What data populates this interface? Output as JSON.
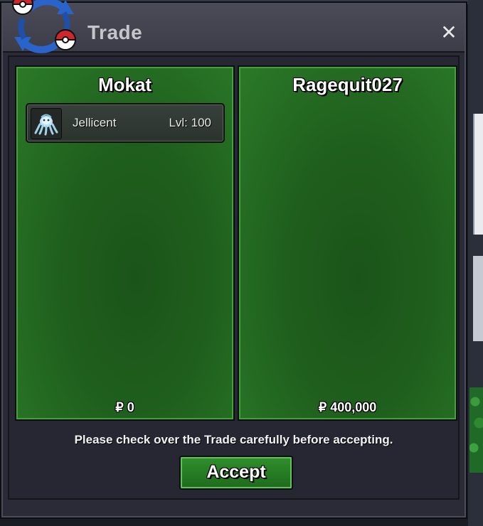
{
  "window": {
    "title": "Trade",
    "close_icon": "close-icon",
    "trade_icon": "trade-swap-pokeball-icon"
  },
  "left_panel": {
    "player": "Mokat",
    "items": [
      {
        "sprite_icon": "jellicent-sprite-icon",
        "name": "Jellicent",
        "level": "Lvl: 100"
      }
    ],
    "money": "₽ 0"
  },
  "right_panel": {
    "player": "Ragequit027",
    "items": [],
    "money": "₽ 400,000"
  },
  "notice": "Please check over the Trade carefully before accepting.",
  "accept_label": "Accept",
  "colors": {
    "panel_green": "#1f5f1d",
    "panel_border": "#41a23a",
    "window_bg": "#2a2b36",
    "accent_red": "#d0262c",
    "accent_blue": "#2a63c9"
  }
}
